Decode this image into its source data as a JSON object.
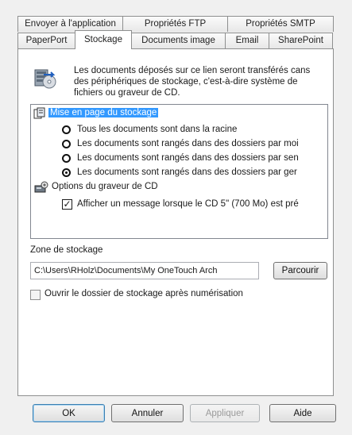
{
  "tabs_back": [
    {
      "label": "Envoyer à l'application"
    },
    {
      "label": "Propriétés FTP"
    },
    {
      "label": "Propriétés SMTP"
    }
  ],
  "tabs_front": [
    {
      "label": "PaperPort"
    },
    {
      "label": "Stockage",
      "active": true
    },
    {
      "label": "Documents image"
    },
    {
      "label": "Email"
    },
    {
      "label": "SharePoint"
    }
  ],
  "description": "Les documents déposés sur ce lien seront transférés cans des périphériques de stockage, c'est-à-dire système de fichiers ou graveur de CD.",
  "tree": {
    "layout_group": {
      "label": "Mise en page du stockage",
      "options": [
        {
          "label": "Tous les documents sont dans la racine",
          "selected": false
        },
        {
          "label": "Les documents sont rangés dans des dossiers par moi",
          "selected": false
        },
        {
          "label": "Les documents sont rangés dans des dossiers par sen",
          "selected": false
        },
        {
          "label": "Les documents sont rangés dans des dossiers par ger",
          "selected": true
        }
      ]
    },
    "cd_group": {
      "label": "Options du graveur de CD",
      "option": {
        "label": "Afficher un message lorsque le CD 5\" (700 Mo) est pré",
        "checked": true
      }
    }
  },
  "storage_zone": {
    "label": "Zone de stockage",
    "path": "C:\\Users\\RHolz\\Documents\\My OneTouch Arch",
    "browse_label": "Parcourir"
  },
  "open_folder_option": {
    "label": "Ouvrir le dossier de stockage après numérisation",
    "checked": false
  },
  "buttons": {
    "ok": "OK",
    "cancel": "Annuler",
    "apply": "Appliquer",
    "help": "Aide"
  }
}
